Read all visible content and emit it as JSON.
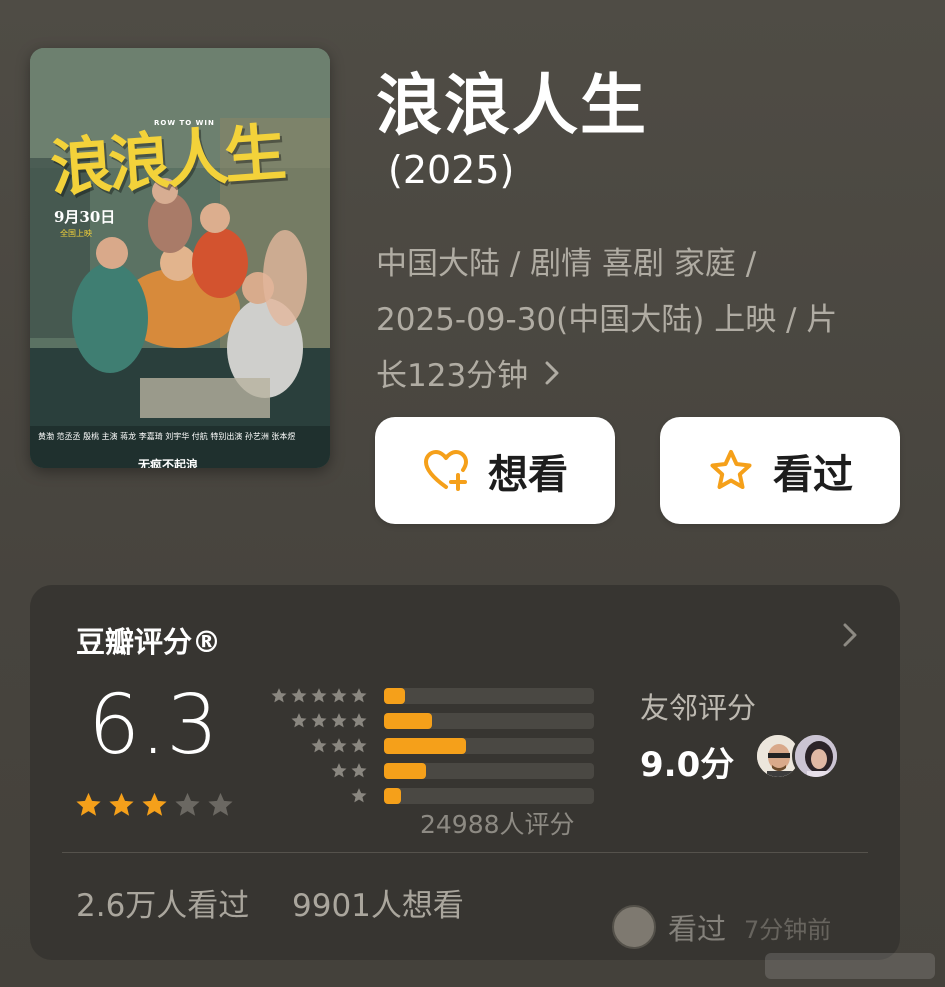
{
  "movie": {
    "title": "浪浪人生",
    "year": "(2025)",
    "meta_line_1": "中国大陆 / 剧情 喜剧 家庭 /",
    "meta_line_2": "2025-09-30(中国大陆) 上映 / 片",
    "meta_line_3": "长123分钟",
    "poster": {
      "title_art": "浪浪人生",
      "english": "ROW TO WIN",
      "release_date": "9月30日",
      "release_note": "全国上映",
      "tagline": "无疯不起浪",
      "credits": "黄渤 范丞丞 殷桃  主演 蒋龙 李嘉琦 刘宇华 付航  特别出演 孙艺洲 张本煜"
    }
  },
  "actions": {
    "want_label": "想看",
    "seen_label": "看过",
    "want_icon": "heart-plus-icon",
    "seen_icon": "star-outline-icon",
    "accent": "#f5a01a"
  },
  "rating": {
    "header": "豆瓣评分®",
    "score": "6.3",
    "stars_filled": 3,
    "stars_total": 5,
    "distribution": [
      {
        "stars": 5,
        "fraction": 0.1
      },
      {
        "stars": 4,
        "fraction": 0.23
      },
      {
        "stars": 3,
        "fraction": 0.39
      },
      {
        "stars": 2,
        "fraction": 0.2
      },
      {
        "stars": 1,
        "fraction": 0.08
      }
    ],
    "count_label": "24988人评分",
    "neighbor_label": "友邻评分",
    "neighbor_score": "9.0分",
    "seen_count": "2.6万人看过",
    "want_count": "9901人想看",
    "activity_action": "看过",
    "activity_time": "7分钟前"
  },
  "colors": {
    "background": "#4a4741",
    "card": "#373531",
    "star": "#f5a01a",
    "star_empty": "#6b6862"
  }
}
